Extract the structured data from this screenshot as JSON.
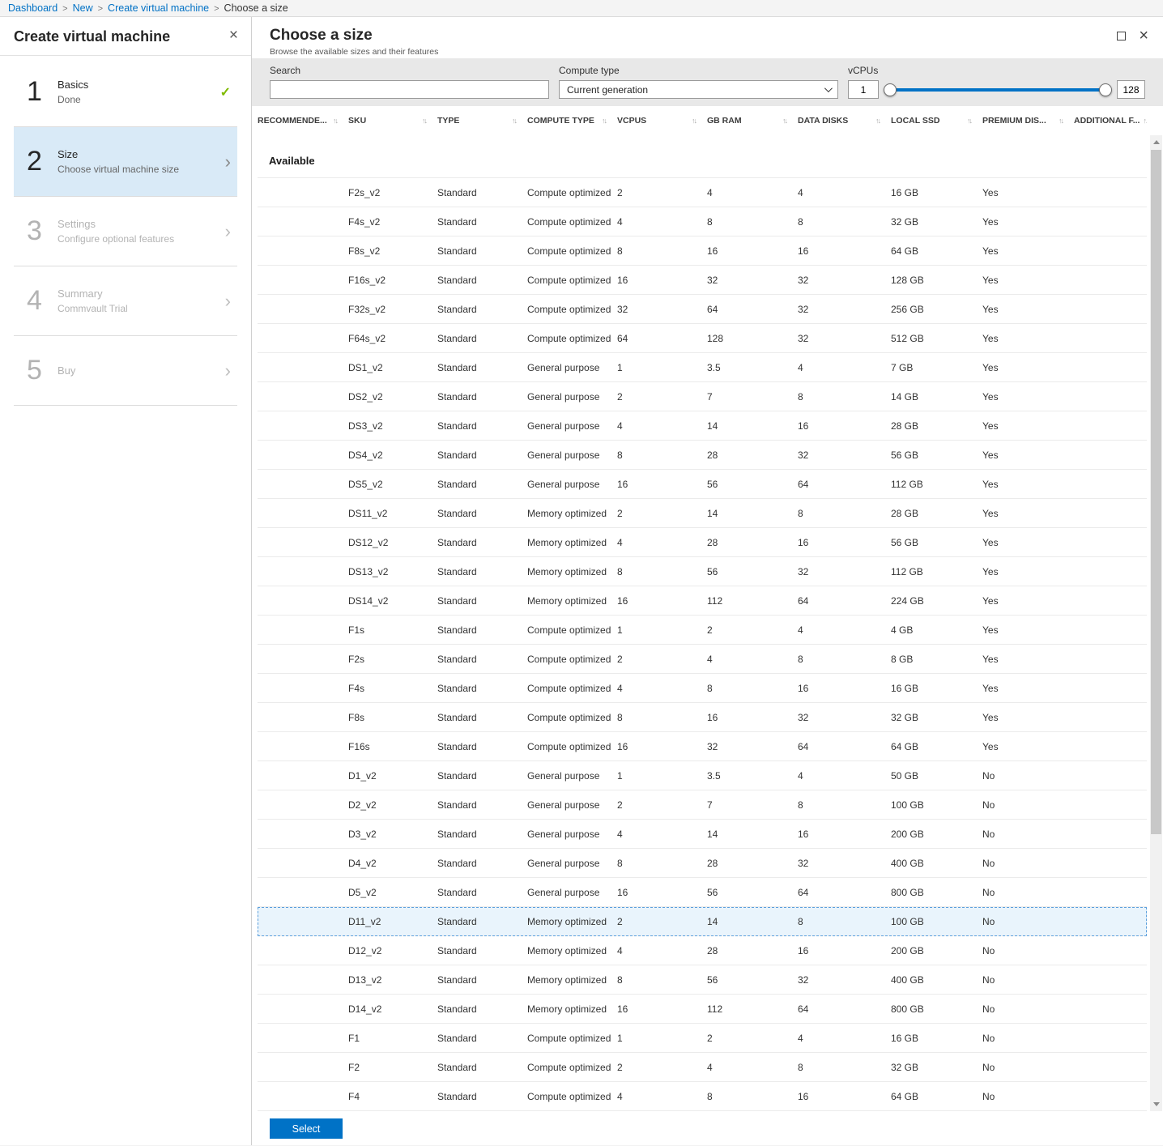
{
  "icons": {
    "close": "×",
    "check": "✓",
    "chevron_right": "›",
    "sort": "↑↓",
    "breadcrumb_sep": ">"
  },
  "breadcrumb": {
    "items": [
      {
        "label": "Dashboard",
        "link": true
      },
      {
        "label": "New",
        "link": true
      },
      {
        "label": "Create virtual machine",
        "link": true
      },
      {
        "label": "Choose a size",
        "link": false
      }
    ]
  },
  "left_panel": {
    "title": "Create virtual machine",
    "steps": [
      {
        "number": "1",
        "title": "Basics",
        "subtitle": "Done",
        "status": "done"
      },
      {
        "number": "2",
        "title": "Size",
        "subtitle": "Choose virtual machine size",
        "status": "active"
      },
      {
        "number": "3",
        "title": "Settings",
        "subtitle": "Configure optional features",
        "status": "disabled"
      },
      {
        "number": "4",
        "title": "Summary",
        "subtitle": "Commvault Trial",
        "status": "disabled"
      },
      {
        "number": "5",
        "title": "Buy",
        "subtitle": "",
        "status": "disabled"
      }
    ]
  },
  "blade": {
    "title": "Choose a size",
    "subtitle": "Browse the available sizes and their features",
    "filters": {
      "search_label": "Search",
      "search_value": "",
      "compute_type_label": "Compute type",
      "compute_type_value": "Current generation",
      "vcpus_label": "vCPUs",
      "vcpus_min": "1",
      "vcpus_max": "128"
    },
    "table": {
      "columns": [
        "RECOMMENDE...",
        "SKU",
        "TYPE",
        "COMPUTE TYPE",
        "VCPUS",
        "GB RAM",
        "DATA DISKS",
        "LOCAL SSD",
        "PREMIUM DIS...",
        "ADDITIONAL F..."
      ],
      "section_label": "Available",
      "rows": [
        {
          "sku": "F2s_v2",
          "type": "Standard",
          "compute_type": "Compute optimized",
          "vcpus": "2",
          "gb_ram": "4",
          "data_disks": "4",
          "local_ssd": "16 GB",
          "premium_disk": "Yes",
          "selected": false
        },
        {
          "sku": "F4s_v2",
          "type": "Standard",
          "compute_type": "Compute optimized",
          "vcpus": "4",
          "gb_ram": "8",
          "data_disks": "8",
          "local_ssd": "32 GB",
          "premium_disk": "Yes",
          "selected": false
        },
        {
          "sku": "F8s_v2",
          "type": "Standard",
          "compute_type": "Compute optimized",
          "vcpus": "8",
          "gb_ram": "16",
          "data_disks": "16",
          "local_ssd": "64 GB",
          "premium_disk": "Yes",
          "selected": false
        },
        {
          "sku": "F16s_v2",
          "type": "Standard",
          "compute_type": "Compute optimized",
          "vcpus": "16",
          "gb_ram": "32",
          "data_disks": "32",
          "local_ssd": "128 GB",
          "premium_disk": "Yes",
          "selected": false
        },
        {
          "sku": "F32s_v2",
          "type": "Standard",
          "compute_type": "Compute optimized",
          "vcpus": "32",
          "gb_ram": "64",
          "data_disks": "32",
          "local_ssd": "256 GB",
          "premium_disk": "Yes",
          "selected": false
        },
        {
          "sku": "F64s_v2",
          "type": "Standard",
          "compute_type": "Compute optimized",
          "vcpus": "64",
          "gb_ram": "128",
          "data_disks": "32",
          "local_ssd": "512 GB",
          "premium_disk": "Yes",
          "selected": false
        },
        {
          "sku": "DS1_v2",
          "type": "Standard",
          "compute_type": "General purpose",
          "vcpus": "1",
          "gb_ram": "3.5",
          "data_disks": "4",
          "local_ssd": "7 GB",
          "premium_disk": "Yes",
          "selected": false
        },
        {
          "sku": "DS2_v2",
          "type": "Standard",
          "compute_type": "General purpose",
          "vcpus": "2",
          "gb_ram": "7",
          "data_disks": "8",
          "local_ssd": "14 GB",
          "premium_disk": "Yes",
          "selected": false
        },
        {
          "sku": "DS3_v2",
          "type": "Standard",
          "compute_type": "General purpose",
          "vcpus": "4",
          "gb_ram": "14",
          "data_disks": "16",
          "local_ssd": "28 GB",
          "premium_disk": "Yes",
          "selected": false
        },
        {
          "sku": "DS4_v2",
          "type": "Standard",
          "compute_type": "General purpose",
          "vcpus": "8",
          "gb_ram": "28",
          "data_disks": "32",
          "local_ssd": "56 GB",
          "premium_disk": "Yes",
          "selected": false
        },
        {
          "sku": "DS5_v2",
          "type": "Standard",
          "compute_type": "General purpose",
          "vcpus": "16",
          "gb_ram": "56",
          "data_disks": "64",
          "local_ssd": "112 GB",
          "premium_disk": "Yes",
          "selected": false
        },
        {
          "sku": "DS11_v2",
          "type": "Standard",
          "compute_type": "Memory optimized",
          "vcpus": "2",
          "gb_ram": "14",
          "data_disks": "8",
          "local_ssd": "28 GB",
          "premium_disk": "Yes",
          "selected": false
        },
        {
          "sku": "DS12_v2",
          "type": "Standard",
          "compute_type": "Memory optimized",
          "vcpus": "4",
          "gb_ram": "28",
          "data_disks": "16",
          "local_ssd": "56 GB",
          "premium_disk": "Yes",
          "selected": false
        },
        {
          "sku": "DS13_v2",
          "type": "Standard",
          "compute_type": "Memory optimized",
          "vcpus": "8",
          "gb_ram": "56",
          "data_disks": "32",
          "local_ssd": "112 GB",
          "premium_disk": "Yes",
          "selected": false
        },
        {
          "sku": "DS14_v2",
          "type": "Standard",
          "compute_type": "Memory optimized",
          "vcpus": "16",
          "gb_ram": "112",
          "data_disks": "64",
          "local_ssd": "224 GB",
          "premium_disk": "Yes",
          "selected": false
        },
        {
          "sku": "F1s",
          "type": "Standard",
          "compute_type": "Compute optimized",
          "vcpus": "1",
          "gb_ram": "2",
          "data_disks": "4",
          "local_ssd": "4 GB",
          "premium_disk": "Yes",
          "selected": false
        },
        {
          "sku": "F2s",
          "type": "Standard",
          "compute_type": "Compute optimized",
          "vcpus": "2",
          "gb_ram": "4",
          "data_disks": "8",
          "local_ssd": "8 GB",
          "premium_disk": "Yes",
          "selected": false
        },
        {
          "sku": "F4s",
          "type": "Standard",
          "compute_type": "Compute optimized",
          "vcpus": "4",
          "gb_ram": "8",
          "data_disks": "16",
          "local_ssd": "16 GB",
          "premium_disk": "Yes",
          "selected": false
        },
        {
          "sku": "F8s",
          "type": "Standard",
          "compute_type": "Compute optimized",
          "vcpus": "8",
          "gb_ram": "16",
          "data_disks": "32",
          "local_ssd": "32 GB",
          "premium_disk": "Yes",
          "selected": false
        },
        {
          "sku": "F16s",
          "type": "Standard",
          "compute_type": "Compute optimized",
          "vcpus": "16",
          "gb_ram": "32",
          "data_disks": "64",
          "local_ssd": "64 GB",
          "premium_disk": "Yes",
          "selected": false
        },
        {
          "sku": "D1_v2",
          "type": "Standard",
          "compute_type": "General purpose",
          "vcpus": "1",
          "gb_ram": "3.5",
          "data_disks": "4",
          "local_ssd": "50 GB",
          "premium_disk": "No",
          "selected": false
        },
        {
          "sku": "D2_v2",
          "type": "Standard",
          "compute_type": "General purpose",
          "vcpus": "2",
          "gb_ram": "7",
          "data_disks": "8",
          "local_ssd": "100 GB",
          "premium_disk": "No",
          "selected": false
        },
        {
          "sku": "D3_v2",
          "type": "Standard",
          "compute_type": "General purpose",
          "vcpus": "4",
          "gb_ram": "14",
          "data_disks": "16",
          "local_ssd": "200 GB",
          "premium_disk": "No",
          "selected": false
        },
        {
          "sku": "D4_v2",
          "type": "Standard",
          "compute_type": "General purpose",
          "vcpus": "8",
          "gb_ram": "28",
          "data_disks": "32",
          "local_ssd": "400 GB",
          "premium_disk": "No",
          "selected": false
        },
        {
          "sku": "D5_v2",
          "type": "Standard",
          "compute_type": "General purpose",
          "vcpus": "16",
          "gb_ram": "56",
          "data_disks": "64",
          "local_ssd": "800 GB",
          "premium_disk": "No",
          "selected": false
        },
        {
          "sku": "D11_v2",
          "type": "Standard",
          "compute_type": "Memory optimized",
          "vcpus": "2",
          "gb_ram": "14",
          "data_disks": "8",
          "local_ssd": "100 GB",
          "premium_disk": "No",
          "selected": true
        },
        {
          "sku": "D12_v2",
          "type": "Standard",
          "compute_type": "Memory optimized",
          "vcpus": "4",
          "gb_ram": "28",
          "data_disks": "16",
          "local_ssd": "200 GB",
          "premium_disk": "No",
          "selected": false
        },
        {
          "sku": "D13_v2",
          "type": "Standard",
          "compute_type": "Memory optimized",
          "vcpus": "8",
          "gb_ram": "56",
          "data_disks": "32",
          "local_ssd": "400 GB",
          "premium_disk": "No",
          "selected": false
        },
        {
          "sku": "D14_v2",
          "type": "Standard",
          "compute_type": "Memory optimized",
          "vcpus": "16",
          "gb_ram": "112",
          "data_disks": "64",
          "local_ssd": "800 GB",
          "premium_disk": "No",
          "selected": false
        },
        {
          "sku": "F1",
          "type": "Standard",
          "compute_type": "Compute optimized",
          "vcpus": "1",
          "gb_ram": "2",
          "data_disks": "4",
          "local_ssd": "16 GB",
          "premium_disk": "No",
          "selected": false
        },
        {
          "sku": "F2",
          "type": "Standard",
          "compute_type": "Compute optimized",
          "vcpus": "2",
          "gb_ram": "4",
          "data_disks": "8",
          "local_ssd": "32 GB",
          "premium_disk": "No",
          "selected": false
        },
        {
          "sku": "F4",
          "type": "Standard",
          "compute_type": "Compute optimized",
          "vcpus": "4",
          "gb_ram": "8",
          "data_disks": "16",
          "local_ssd": "64 GB",
          "premium_disk": "No",
          "selected": false
        }
      ]
    },
    "select_button_label": "Select",
    "accent_color": "#0072c6"
  }
}
